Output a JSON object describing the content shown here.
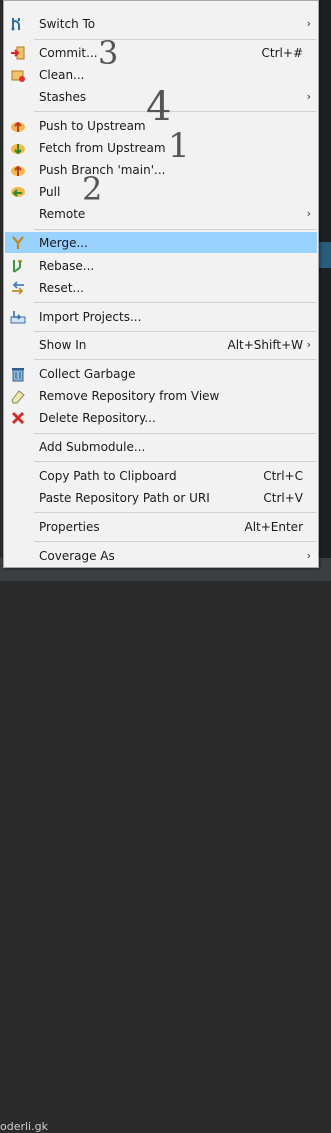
{
  "background": {
    "bottom_text": "oderli.gk"
  },
  "annotations": [
    "3",
    "4",
    "1",
    "2"
  ],
  "menu": {
    "items": [
      {
        "label": "Switch To",
        "icon": "switch-icon",
        "submenu": true
      },
      {
        "label": "Commit...",
        "icon": "commit-icon",
        "shortcut": "Ctrl+#"
      },
      {
        "label": "Clean...",
        "icon": "clean-icon"
      },
      {
        "label": "Stashes",
        "submenu": true
      },
      {
        "label": "Push to Upstream",
        "icon": "push-icon"
      },
      {
        "label": "Fetch from Upstream",
        "icon": "fetch-icon"
      },
      {
        "label": "Push Branch 'main'...",
        "icon": "push-branch-icon"
      },
      {
        "label": "Pull",
        "icon": "pull-icon"
      },
      {
        "label": "Remote",
        "submenu": true
      },
      {
        "label": "Merge...",
        "icon": "merge-icon",
        "highlighted": true
      },
      {
        "label": "Rebase...",
        "icon": "rebase-icon"
      },
      {
        "label": "Reset...",
        "icon": "reset-icon"
      },
      {
        "label": "Import Projects...",
        "icon": "import-icon"
      },
      {
        "label": "Show In",
        "shortcut": "Alt+Shift+W",
        "submenu": true
      },
      {
        "label": "Collect Garbage",
        "icon": "trash-icon"
      },
      {
        "label": "Remove Repository from View",
        "icon": "eraser-icon"
      },
      {
        "label": "Delete Repository...",
        "icon": "delete-icon"
      },
      {
        "label": "Add Submodule..."
      },
      {
        "label": "Copy Path to Clipboard",
        "shortcut": "Ctrl+C"
      },
      {
        "label": "Paste Repository Path or URI",
        "shortcut": "Ctrl+V"
      },
      {
        "label": "Properties",
        "shortcut": "Alt+Enter"
      },
      {
        "label": "Coverage As",
        "submenu": true
      }
    ],
    "highlight_color": "#99d1ff",
    "submenu_arrow": "›"
  }
}
